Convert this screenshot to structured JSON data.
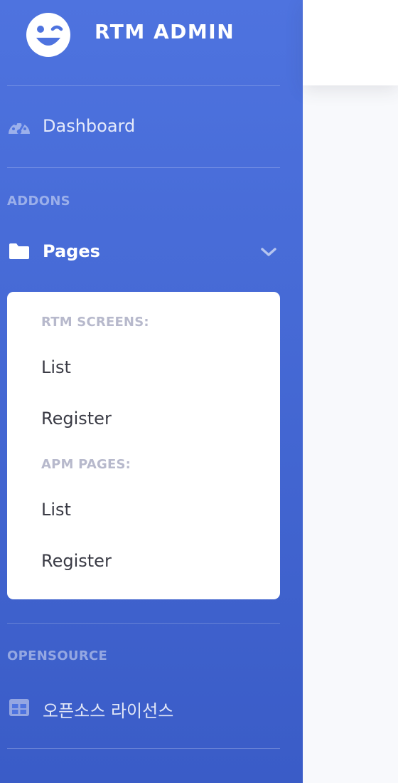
{
  "brand": {
    "name": "RTM ADMIN",
    "icon": "wink-face-icon"
  },
  "nav": {
    "dashboard": {
      "label": "Dashboard",
      "icon": "tachometer-icon"
    },
    "addons_heading": "ADDONS",
    "pages": {
      "label": "Pages",
      "icon": "folder-icon",
      "expanded": true,
      "groups": [
        {
          "heading": "RTM SCREENS:",
          "items": [
            "List",
            "Register"
          ]
        },
        {
          "heading": "APM PAGES:",
          "items": [
            "List",
            "Register"
          ]
        }
      ]
    },
    "opensource_heading": "OPENSOURCE",
    "license": {
      "label": "오픈소스 라이선스",
      "icon": "table-icon"
    }
  },
  "colors": {
    "sidebar_top": "#4e73df",
    "sidebar_bottom": "#3a5cc7",
    "panel_bg": "#ffffff",
    "panel_heading": "#b7b9cc",
    "panel_item": "#3a3b45",
    "page_bg": "#f8f9fc"
  }
}
